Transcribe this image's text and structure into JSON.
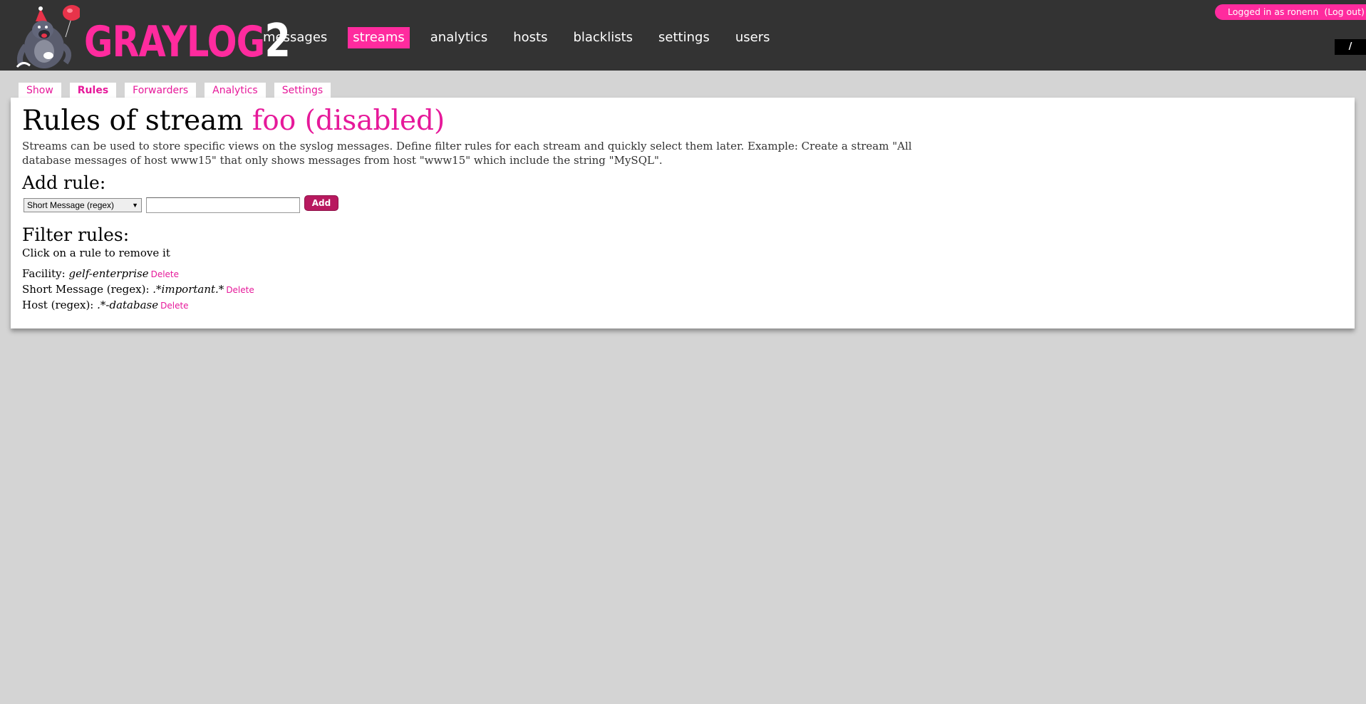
{
  "header": {
    "logo": {
      "word": "GRAYLOG",
      "number": "2"
    },
    "nav": [
      {
        "label": "messages",
        "active": false
      },
      {
        "label": "streams",
        "active": true
      },
      {
        "label": "analytics",
        "active": false
      },
      {
        "label": "hosts",
        "active": false
      },
      {
        "label": "blacklists",
        "active": false
      },
      {
        "label": "settings",
        "active": false
      },
      {
        "label": "users",
        "active": false
      }
    ],
    "user": {
      "logged_in_text": "Logged in as ronenn",
      "logout_label": "(Log out)"
    },
    "slash": "/"
  },
  "subtabs": [
    {
      "label": "Show",
      "active": false
    },
    {
      "label": "Rules",
      "active": true
    },
    {
      "label": "Forwarders",
      "active": false
    },
    {
      "label": "Analytics",
      "active": false
    },
    {
      "label": "Settings",
      "active": false
    }
  ],
  "page": {
    "title_prefix": "Rules of stream",
    "stream_name": "foo (disabled)",
    "description": "Streams can be used to store specific views on the syslog messages. Define filter rules for each stream and quickly select them later. Example: Create a stream \"All database messages of host www15\" that only shows messages from host \"www15\" which include the string \"MySQL\".",
    "add_rule_heading": "Add rule:",
    "rule_type_selected": "Short Message (regex)",
    "rule_value": "",
    "add_button": "Add",
    "filter_heading": "Filter rules:",
    "filter_hint": "Click on a rule to remove it",
    "rules": [
      {
        "type": "Facility:",
        "value": "gelf-enterprise",
        "delete": "Delete"
      },
      {
        "type": "Short Message (regex):",
        "value": ".*important.*",
        "delete": "Delete"
      },
      {
        "type": "Host (regex):",
        "value": ".*-database",
        "delete": "Delete"
      }
    ]
  },
  "colors": {
    "accent": "#ff2b9e",
    "link": "#e6199a",
    "topbar": "#333333",
    "background": "#d4d4d4",
    "button": "#b8195f"
  }
}
